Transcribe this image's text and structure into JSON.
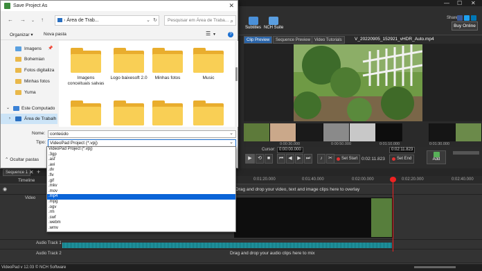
{
  "dialog": {
    "title": "Save Project As",
    "address": "Área de Trab...",
    "search_placeholder": "Pesquisar em Área de Traba...",
    "organize": "Organizar ▾",
    "new_folder": "Nova pasta",
    "nav_items": [
      "Imagens",
      "Bohemian",
      "Fotos digitaliza",
      "Minhas fotos",
      "Yuma",
      "Este Computado",
      "Área de Trabalh"
    ],
    "files": [
      "Imagens conceituais salvas",
      "Logo baixesoft 2.0",
      "Minhas fotos",
      "Music",
      "",
      "",
      "",
      ""
    ],
    "name_label": "Nome:",
    "name_value": "conteúdo",
    "type_label": "Tipo:",
    "type_value": "VideoPad Project (*.vpj)",
    "hide_folders": "Ocultar pastas",
    "type_options": [
      "VideoPad Project (*.vpj)",
      ".3gp",
      ".asf",
      ".avi",
      ".dv",
      ".flv",
      ".gif",
      ".mkv",
      ".mov",
      ".mp4",
      ".mpg",
      ".ogv",
      ".rm",
      ".swf",
      ".webm",
      ".wmv"
    ],
    "highlighted_option": ".mp4"
  },
  "app": {
    "toolbar": {
      "subtitles": "Subtitles",
      "nch_suite": "NCH Suite",
      "buy_online": "Buy Online",
      "share": "Share"
    },
    "tabs": {
      "clip_preview": "Clip Preview",
      "sequence_preview": "Sequence Preview",
      "video_tutorials": "Video Tutorials"
    },
    "clip_title": "V_20220905_152921_vHDR_Auto.mp4",
    "ruler": [
      "0:00:30.000",
      "0:00:50.000",
      "0:01:10.000",
      "0:01:30.000"
    ],
    "cursor_label": "Cursor:",
    "cursor_time": "0:00:00.000",
    "end_time": "0:02:11.823",
    "duration": "0:02:11.823",
    "set_start": "Set Start",
    "set_end": "Set End",
    "add": "Add",
    "sequence_tab": "Sequence 1",
    "timeline_label": "Timeline",
    "timeline_ruler": [
      "0:01:20.000",
      "0:01:40.000",
      "0:02:00.000",
      "0:02:20.000",
      "0:02:40.000"
    ],
    "video_track": "Video",
    "overlay_hint": "Drag and drop your video, text and image clips here to overlay",
    "audio_track_1": "Audio Track 1",
    "audio_track_2": "Audio Track 2",
    "audio_hint": "Drag and drop your audio clips here to mix",
    "status": "VideoPad v 12.03 © NCH Software"
  },
  "colors": {
    "accent": "#1a6fd1",
    "highlight": "#0a64d8",
    "folder": "#f9cf55",
    "playhead": "#e22222",
    "waveform": "#2bb3c0"
  }
}
